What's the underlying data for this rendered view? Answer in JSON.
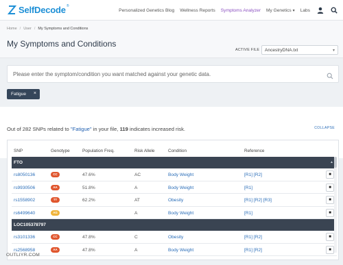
{
  "brand": {
    "name": "SelfDecode",
    "tm": "®"
  },
  "nav": {
    "items": [
      {
        "label": "Personalized Genetics Blog"
      },
      {
        "label": "Wellness Reports"
      },
      {
        "label": "Symptoms Analyzer"
      },
      {
        "label": "My Genetics"
      },
      {
        "label": "Labs"
      }
    ],
    "dropdown_caret": "▾",
    "icons": [
      "user-icon",
      "search-icon"
    ]
  },
  "breadcrumb": [
    "Home",
    "User",
    "My Symptoms and Conditions"
  ],
  "page": {
    "title": "My Symptoms and Conditions"
  },
  "active_file": {
    "label": "ACTIVE FILE",
    "value": "AncestryDNA.txt"
  },
  "search": {
    "placeholder": "Please enter the symptom/condition you want matched against your genetic data."
  },
  "selected_tag": {
    "label": "Fatigue",
    "close": "×"
  },
  "summary": {
    "prefix": "Out of 282 SNPs related to ",
    "query": "\"Fatigue\"",
    "middle": " in your file, ",
    "count": "119",
    "suffix": " indicates increased risk.",
    "collapse_label": "COLLAPSE"
  },
  "table": {
    "columns": [
      "SNP",
      "Genotype",
      "Population Freq.",
      "Risk Allele",
      "Condition",
      "Reference"
    ],
    "groups": [
      {
        "gene": "FTO",
        "rows": [
          {
            "snp": "rs8050136",
            "genotype": "CC",
            "genotype_color": "#e0562e",
            "freq": "47.6%",
            "risk_allele": "AC",
            "condition": "Body Weight",
            "reference": "[R1] [R2]"
          },
          {
            "snp": "rs9930506",
            "genotype": "AA",
            "genotype_color": "#e0562e",
            "freq": "51.8%",
            "risk_allele": "A",
            "condition": "Body Weight",
            "reference": "[R1]"
          },
          {
            "snp": "rs1558902",
            "genotype": "TT",
            "genotype_color": "#e0562e",
            "freq": "62.2%",
            "risk_allele": "AT",
            "condition": "Obesity",
            "reference": "[R1] [R2] [R3]"
          },
          {
            "snp": "rs6499640",
            "genotype": "AG",
            "genotype_color": "#f0b43a",
            "freq": "",
            "risk_allele": "A",
            "condition": "Body Weight",
            "reference": "[R1]"
          }
        ]
      },
      {
        "gene": "LOC105378797",
        "rows": [
          {
            "snp": "rs3101336",
            "genotype": "CC",
            "genotype_color": "#e0562e",
            "freq": "47.8%",
            "risk_allele": "C",
            "condition": "Obesity",
            "reference": "[R1] [R2]"
          },
          {
            "snp": "rs2568958",
            "genotype": "AA",
            "genotype_color": "#e0562e",
            "freq": "47.8%",
            "risk_allele": "A",
            "condition": "Body Weight",
            "reference": "[R1] [R2]"
          }
        ]
      }
    ],
    "pin_icon": "pin-icon"
  },
  "watermark": "OUTLIYR.COM"
}
